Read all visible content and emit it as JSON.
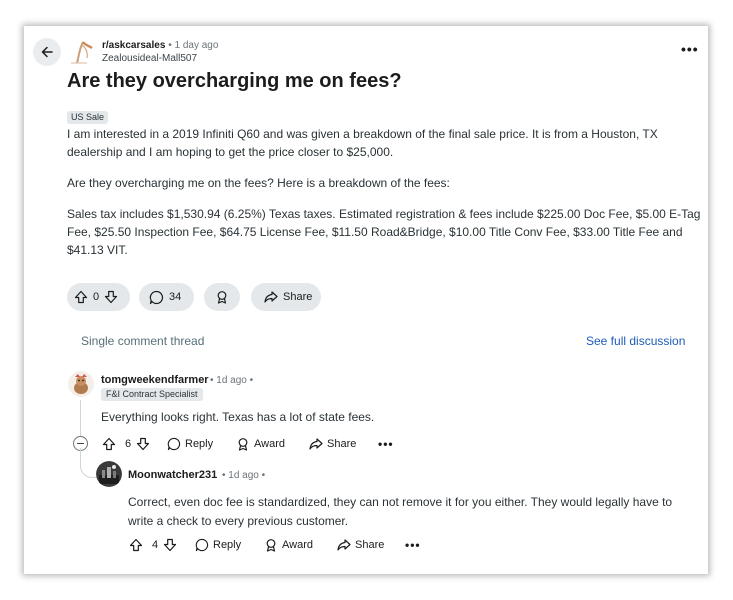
{
  "post": {
    "subreddit": "r/askcarsales",
    "separator": "•",
    "time": "1 day ago",
    "author": "Zealousideal-Mall507",
    "title": "Are they overcharging me on fees?",
    "flair": "US Sale",
    "paragraphs": [
      "I am interested in a 2019 Infiniti Q60 and was given a breakdown of the final sale price. It is from a Houston, TX dealership and I am hoping to get the price closer to $25,000.",
      "Are they overcharging me on the fees? Here is a breakdown of the fees:",
      "Sales tax includes $1,530.94 (6.25%) Texas taxes. Estimated registration & fees include $225.00 Doc Fee, $5.00 E-Tag Fee, $25.50 Inspection Fee, $64.75 License Fee, $11.50 Road&Bridge, $10.00 Title Conv Fee, $33.00 Title Fee and $41.13 VIT."
    ],
    "vote_count": "0",
    "comment_count": "34",
    "share_label": "Share",
    "more_label": "•••"
  },
  "thread": {
    "label": "Single comment thread",
    "full_discussion_label": "See full discussion"
  },
  "comments": [
    {
      "user": "tomgweekendfarmer",
      "meta": "• 1d ago •",
      "flair": "F&I Contract Specialist",
      "text": "Everything looks right. Texas has a lot of state fees.",
      "votes": "6",
      "reply_label": "Reply",
      "award_label": "Award",
      "share_label": "Share",
      "more_label": "•••"
    },
    {
      "user": "Moonwatcher231",
      "meta": "• 1d ago •",
      "text": "Correct, even doc fee is standardized, they can not remove it for you either. They would legally have to write a check to every previous customer.",
      "votes": "4",
      "reply_label": "Reply",
      "award_label": "Award",
      "share_label": "Share",
      "more_label": "•••"
    }
  ],
  "icons": {
    "back": "arrow-left-icon",
    "upvote": "arrow-up-icon",
    "downvote": "arrow-down-icon",
    "comment": "speech-bubble-icon",
    "award": "award-icon",
    "share": "share-arrow-icon",
    "collapse": "minus-circle-icon"
  },
  "colors": {
    "link": "#1e5bb8",
    "pill_bg": "#e4e8ea",
    "muted_text": "#6b7479"
  }
}
